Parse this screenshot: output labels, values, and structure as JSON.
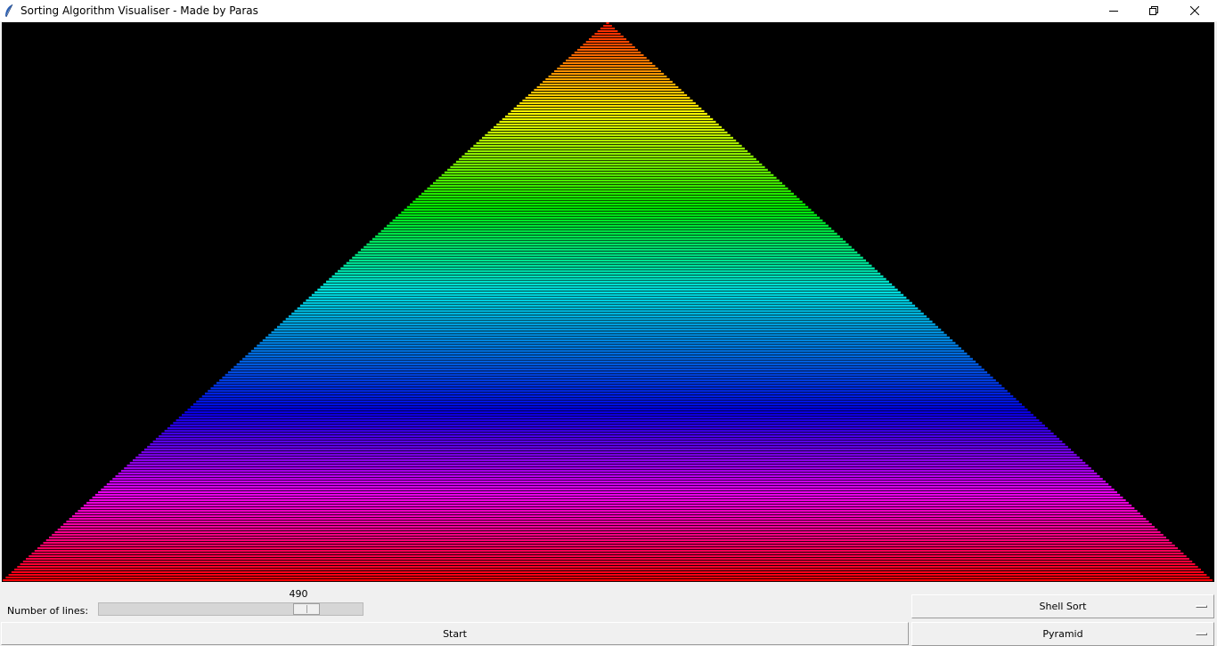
{
  "window": {
    "title": "Sorting Algorithm Visualiser - Made by Paras",
    "icon": "feather-icon"
  },
  "visualisation": {
    "background": "#000000",
    "shape": "pyramid",
    "line_count": 490,
    "color_order": "rainbow: red at apex to cyan mid to blue to magenta to red at base"
  },
  "controls": {
    "slider_label": "Number of lines:",
    "slider_value": "490",
    "slider_fraction": 0.82,
    "start_label": "Start",
    "algorithm_selected": "Shell Sort",
    "shape_selected": "Pyramid"
  }
}
